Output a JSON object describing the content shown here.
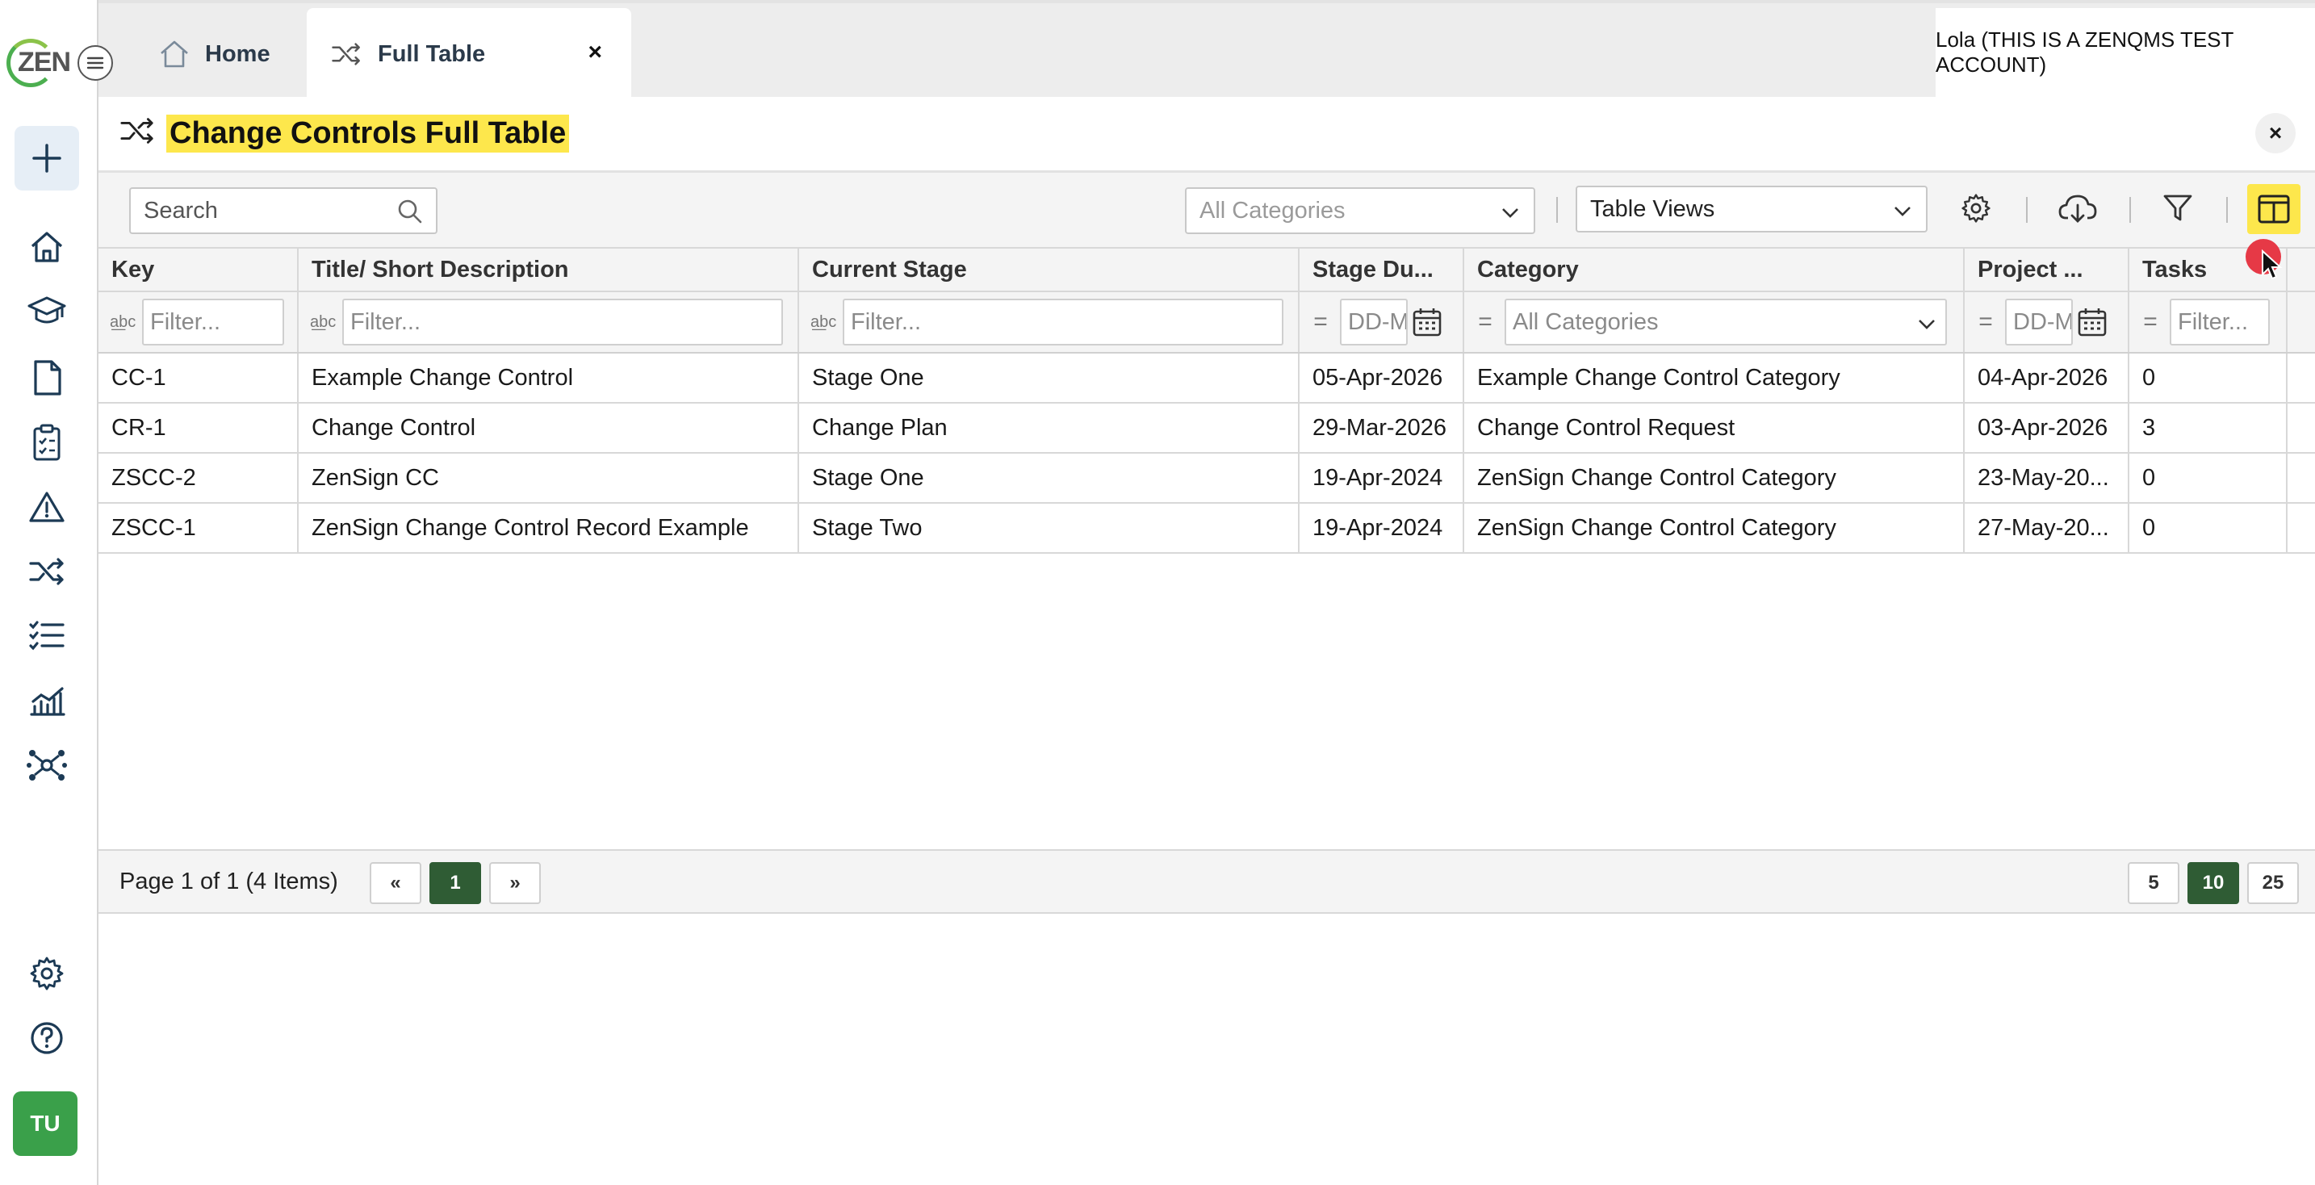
{
  "app": {
    "logo_text": "ZEN",
    "user_initials": "TU"
  },
  "tabs": [
    {
      "label": "Home"
    },
    {
      "label": "Full Table",
      "close": "×"
    }
  ],
  "user_label": "Lola (THIS IS A ZENQMS TEST ACCOUNT)",
  "page": {
    "title": "Change Controls Full Table",
    "close": "×"
  },
  "toolbar": {
    "search_placeholder": "Search",
    "categories_placeholder": "All Categories",
    "table_views_label": "Table Views"
  },
  "table": {
    "columns": [
      {
        "label": "Key",
        "filter": "text",
        "placeholder": "Filter..."
      },
      {
        "label": "Title/ Short Description",
        "filter": "text",
        "placeholder": "Filter..."
      },
      {
        "label": "Current Stage",
        "filter": "text",
        "placeholder": "Filter..."
      },
      {
        "label": "Stage Du...",
        "filter": "date",
        "placeholder": "DD-M"
      },
      {
        "label": "Category",
        "filter": "select",
        "placeholder": "All Categories"
      },
      {
        "label": "Project ...",
        "filter": "date",
        "placeholder": "DD-M"
      },
      {
        "label": "Tasks",
        "filter": "number",
        "placeholder": "Filter..."
      }
    ],
    "rows": [
      {
        "key": "CC-1",
        "title": "Example Change Control",
        "stage": "Stage One",
        "stage_due": "05-Apr-2026",
        "category": "Example Change Control Category",
        "project": "04-Apr-2026",
        "tasks": "0"
      },
      {
        "key": "CR-1",
        "title": "Change Control",
        "stage": "Change Plan",
        "stage_due": "29-Mar-2026",
        "category": "Change Control Request",
        "project": "03-Apr-2026",
        "tasks": "3"
      },
      {
        "key": "ZSCC-2",
        "title": "ZenSign CC",
        "stage": "Stage One",
        "stage_due": "19-Apr-2024",
        "category": "ZenSign Change Control Category",
        "project": "23-May-20...",
        "tasks": "0"
      },
      {
        "key": "ZSCC-1",
        "title": "ZenSign Change Control Record Example",
        "stage": "Stage Two",
        "stage_due": "19-Apr-2024",
        "category": "ZenSign Change Control Category",
        "project": "27-May-20...",
        "tasks": "0"
      }
    ]
  },
  "pager": {
    "info": "Page 1 of 1 (4 Items)",
    "prev": "«",
    "current": "1",
    "next": "»",
    "sizes": [
      "5",
      "10",
      "25"
    ],
    "active_size": "10"
  },
  "colors": {
    "accent_highlight": "#fde74c",
    "link": "#1f5fa8",
    "active_button": "#2f5c34",
    "avatar": "#3aa04a"
  },
  "icons": {
    "sidebar": [
      "plus-icon",
      "home-icon",
      "training-cap-icon",
      "document-icon",
      "clipboard-icon",
      "warning-icon",
      "shuffle-icon",
      "checklist-icon",
      "chart-icon",
      "network-icon",
      "gear-icon",
      "help-icon"
    ]
  }
}
